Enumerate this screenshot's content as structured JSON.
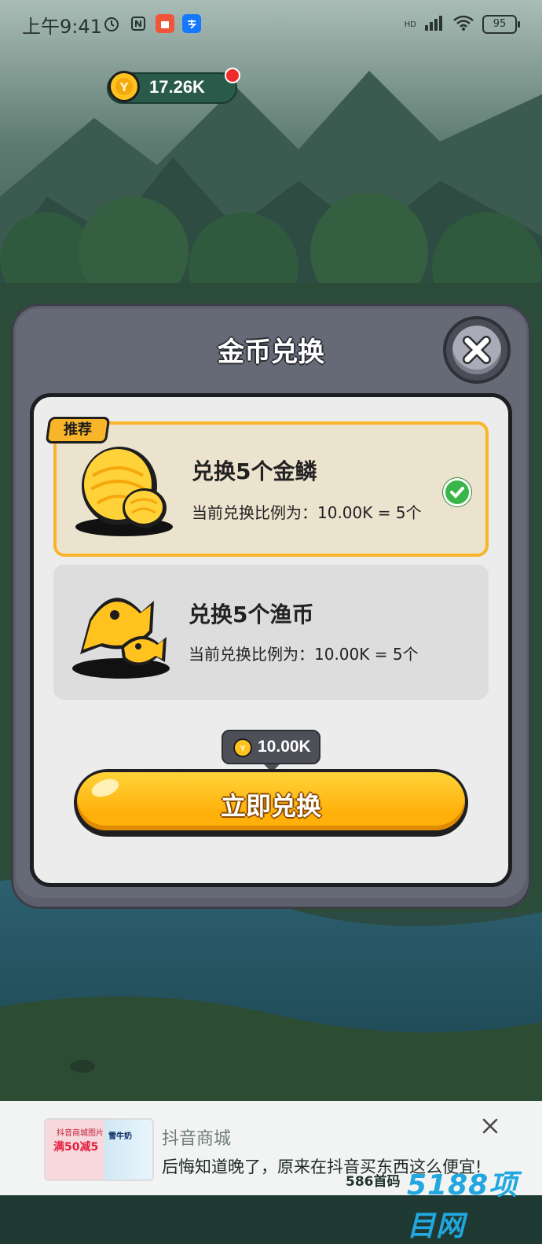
{
  "status_bar": {
    "time": "上午9:41",
    "app_icon_1": "alarm-icon",
    "app_icon_2": "nfc-icon",
    "app_icon_3": "shopping-icon",
    "app_icon_4": "alipay-icon",
    "network": "HD",
    "battery": "95"
  },
  "header": {
    "coin_balance": "17.26K",
    "coin_symbol": "Y",
    "has_notification": true
  },
  "modal": {
    "title": "金币兑换",
    "badge_label": "推荐",
    "options": [
      {
        "name": "兑换5个金鳞",
        "rate": "当前兑换比例为：10.00K = 5个",
        "selected": true,
        "icon": "golden-scale-icon"
      },
      {
        "name": "兑换5个渔币",
        "rate": "当前兑换比例为：10.00K = 5个",
        "selected": false,
        "icon": "fish-coin-icon"
      }
    ],
    "cost": "10.00K",
    "cost_symbol": "Y",
    "button_label": "立即兑换"
  },
  "ad": {
    "title": "抖音商城",
    "text": "后悔知道晚了，原来在抖音买东西这么便宜!",
    "thumb_line1": "抖音商城图片",
    "thumb_line2": "满50减5",
    "thumb_brand": "雪牛奶"
  },
  "watermark": {
    "text1": "586首码",
    "text2": "5188项目网"
  },
  "colors": {
    "accent": "#f8b52a",
    "button": "#ffc21f",
    "panel": "#ececec",
    "modal_frame": "#5d606c",
    "check": "#3ab54a",
    "notification": "#ef2b2b"
  }
}
